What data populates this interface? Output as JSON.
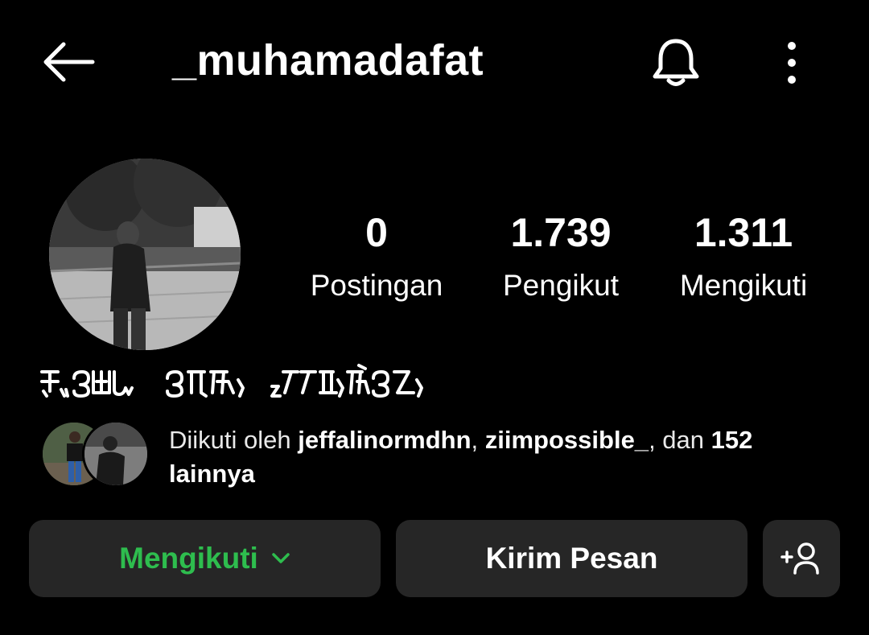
{
  "header": {
    "username": "_muhamadafat",
    "back_icon": "arrow-left-icon",
    "notification_icon": "bell-icon",
    "more_icon": "more-vertical-icon"
  },
  "profile": {
    "display_name": "ꦗꦸꦧꦤꦸ ꦧꦺꦴꦏ꧀ ꦏꦼꦩꦤꦺꦲꦤꦺ",
    "stats": {
      "posts": {
        "value": "0",
        "label": "Postingan"
      },
      "followers": {
        "value": "1.739",
        "label": "Pengikut"
      },
      "following": {
        "value": "1.311",
        "label": "Mengikuti"
      }
    }
  },
  "mutual": {
    "prefix": "Diikuti oleh ",
    "user1": "jeffalinormdhn",
    "sep": ", ",
    "user2": "ziimpossible_",
    "mid": ", dan ",
    "count": "152",
    "suffix": "lainnya"
  },
  "actions": {
    "following_label": "Mengikuti",
    "following_color": "#2ebd4e",
    "message_label": "Kirim Pesan",
    "suggest_icon": "add-person-icon"
  }
}
